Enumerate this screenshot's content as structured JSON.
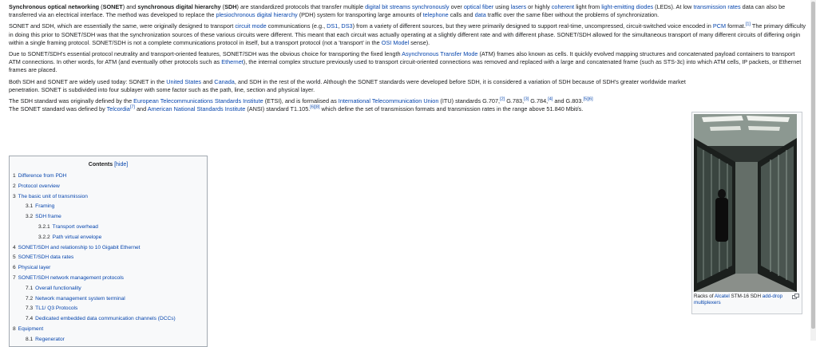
{
  "paragraphs": {
    "p1": [
      "Synchronous optical networking",
      " (",
      "SONET",
      ") and ",
      "synchronous digital hierarchy",
      " (",
      "SDH",
      ") are standardized protocols that transfer multiple ",
      "digital bit streams",
      " ",
      "synchronously",
      " over ",
      "optical fiber",
      " using ",
      "lasers",
      " or highly ",
      "coherent",
      " light from ",
      "light-emitting diodes",
      " (LEDs). At low ",
      "transmission rates",
      " data can also be transferred via an electrical interface. The method was developed to replace the ",
      "plesiochronous digital hierarchy",
      " (PDH) system for transporting large amounts of ",
      "telephone",
      " calls and ",
      "data",
      " traffic over the same fiber without the problems of synchronization."
    ],
    "p2": [
      "SONET and SDH, which are essentially the same, were originally designed to transport ",
      "circuit mode",
      " communications (e.g., ",
      "DS1",
      ", ",
      "DS3",
      ") from a variety of different sources, but they were primarily designed to support real-time, uncompressed, circuit-switched voice encoded in ",
      "PCM",
      " format.",
      "[1]",
      " The primary difficulty in doing this prior to SONET/SDH was that the synchronization sources of these various circuits were different. This meant that each circuit was actually operating at a slightly different rate and with different phase. SONET/SDH allowed for the simultaneous transport of many different circuits of differing origin within a single framing protocol. SONET/SDH is not a complete communications protocol in itself, but a transport protocol (not a 'transport' in the ",
      "OSI Model",
      " sense)."
    ],
    "p3": [
      "Due to SONET/SDH's essential protocol neutrality and transport-oriented features, SONET/SDH was the obvious choice for transporting the fixed length ",
      "Asynchronous Transfer Mode",
      " (ATM) frames also known as cells. It quickly evolved mapping structures and concatenated payload containers to transport ATM connections. In other words, for ATM (and eventually other protocols such as ",
      "Ethernet",
      "), the internal complex structure previously used to transport circuit-oriented connections was removed and replaced with a large and concatenated frame (such as STS-3c) into which ATM cells, IP packets, or Ethernet frames are placed."
    ],
    "p4": [
      "Both SDH and SONET are widely used today: SONET in the ",
      "United States",
      " and ",
      "Canada",
      ", and SDH in the rest of the world. Although the SONET standards were developed before SDH, it is considered a variation of SDH because of SDH's greater worldwide market penetration. SONET is subdivided into four sublayer with some factor such as the path, line, section and physical layer."
    ],
    "p5": [
      "The SDH standard was originally defined by the ",
      "European Telecommunications Standards Institute",
      " (ETSI), and is formalised as ",
      "International Telecommunication Union",
      " (ITU) standards G.707,",
      "[2]",
      " G.783,",
      "[3]",
      " G.784,",
      "[4]",
      " and G.803.",
      "[5][6]",
      " The SONET standard was defined by ",
      "Telcordia",
      "[7]",
      " and ",
      "American National Standards Institute",
      " (ANSI) standard T1.105.",
      "[6][8]",
      " which define the set of transmission formats and transmission rates in the range above 51.840 Mbit/s."
    ]
  },
  "thumb": {
    "caption_pre": "Racks of ",
    "caption_link1": "Alcatel",
    "caption_mid": " STM-16 SDH ",
    "caption_link2": "add-drop multiplexers",
    "enlarge_icon": "enlarge-icon"
  },
  "toc": {
    "title": "Contents",
    "hide_label": "[hide]",
    "items": [
      {
        "num": "1",
        "label": "Difference from PDH",
        "level": 1
      },
      {
        "num": "2",
        "label": "Protocol overview",
        "level": 1
      },
      {
        "num": "3",
        "label": "The basic unit of transmission",
        "level": 1
      },
      {
        "num": "3.1",
        "label": "Framing",
        "level": 2
      },
      {
        "num": "3.2",
        "label": "SDH frame",
        "level": 2
      },
      {
        "num": "3.2.1",
        "label": "Transport overhead",
        "level": 3
      },
      {
        "num": "3.2.2",
        "label": "Path virtual envelope",
        "level": 3
      },
      {
        "num": "4",
        "label": "SONET/SDH and relationship to 10 Gigabit Ethernet",
        "level": 1
      },
      {
        "num": "5",
        "label": "SONET/SDH data rates",
        "level": 1
      },
      {
        "num": "6",
        "label": "Physical layer",
        "level": 1
      },
      {
        "num": "7",
        "label": "SONET/SDH network management protocols",
        "level": 1
      },
      {
        "num": "7.1",
        "label": "Overall functionality",
        "level": 2
      },
      {
        "num": "7.2",
        "label": "Network management system terminal",
        "level": 2
      },
      {
        "num": "7.3",
        "label": "TL1/ Q3 Protocols",
        "level": 2
      },
      {
        "num": "7.4",
        "label": "Dedicated embedded data communication channels (DCCs)",
        "level": 2
      },
      {
        "num": "8",
        "label": "Equipment",
        "level": 1
      },
      {
        "num": "8.1",
        "label": "Regenerator",
        "level": 2
      }
    ]
  },
  "colors": {
    "link": "#0645ad",
    "text": "#202122",
    "toc_bg": "#f8f9fa",
    "toc_border": "#a2a9b1"
  }
}
